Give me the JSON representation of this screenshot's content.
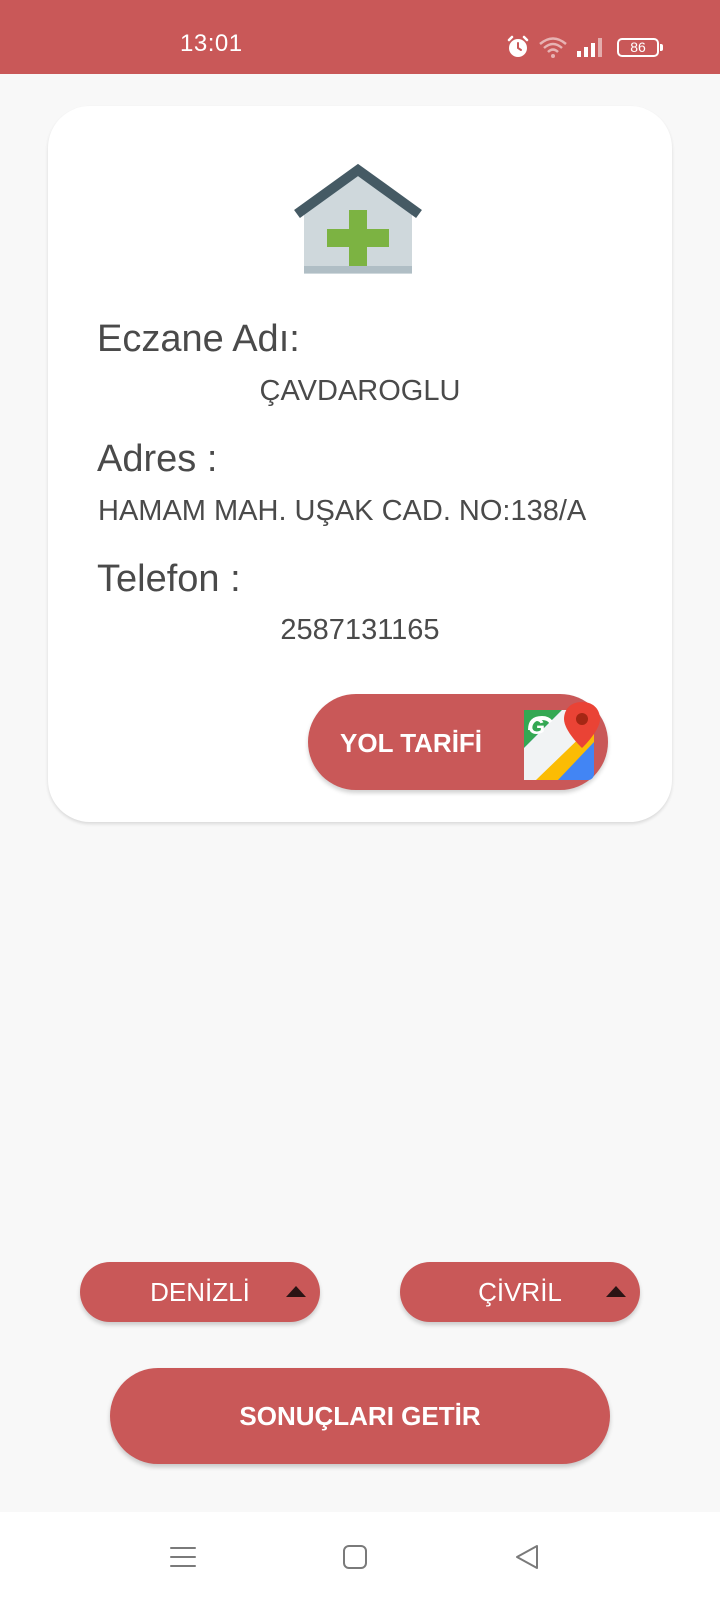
{
  "status_bar": {
    "time": "13:01",
    "battery_level": "86",
    "icons": [
      "alarm-icon",
      "wifi-icon",
      "cellular-signal-icon",
      "battery-icon"
    ]
  },
  "pharmacy_card": {
    "icon": "pharmacy-icon",
    "name_label": "Eczane Adı:",
    "name_value": "ÇAVDAROGLU",
    "address_label": "Adres :",
    "address_value": "HAMAM MAH. UŞAK CAD. NO:138/A",
    "phone_label": "Telefon :",
    "phone_value": "2587131165",
    "directions_button": {
      "label": "YOL TARİFİ",
      "icon": "google-maps-icon"
    }
  },
  "filters": {
    "city": {
      "selected": "DENİZLİ",
      "icon": "dropdown-arrow-icon"
    },
    "district": {
      "selected": "ÇİVRİL",
      "icon": "dropdown-arrow-icon"
    }
  },
  "submit_button": {
    "label": "SONUÇLARI GETİR"
  },
  "nav_bar": {
    "icons": [
      "menu-icon",
      "home-square-icon",
      "back-triangle-icon"
    ]
  },
  "colors": {
    "accent": "#c95858",
    "text": "#4a4a4a",
    "background": "#f8f8f8",
    "card": "#ffffff"
  }
}
